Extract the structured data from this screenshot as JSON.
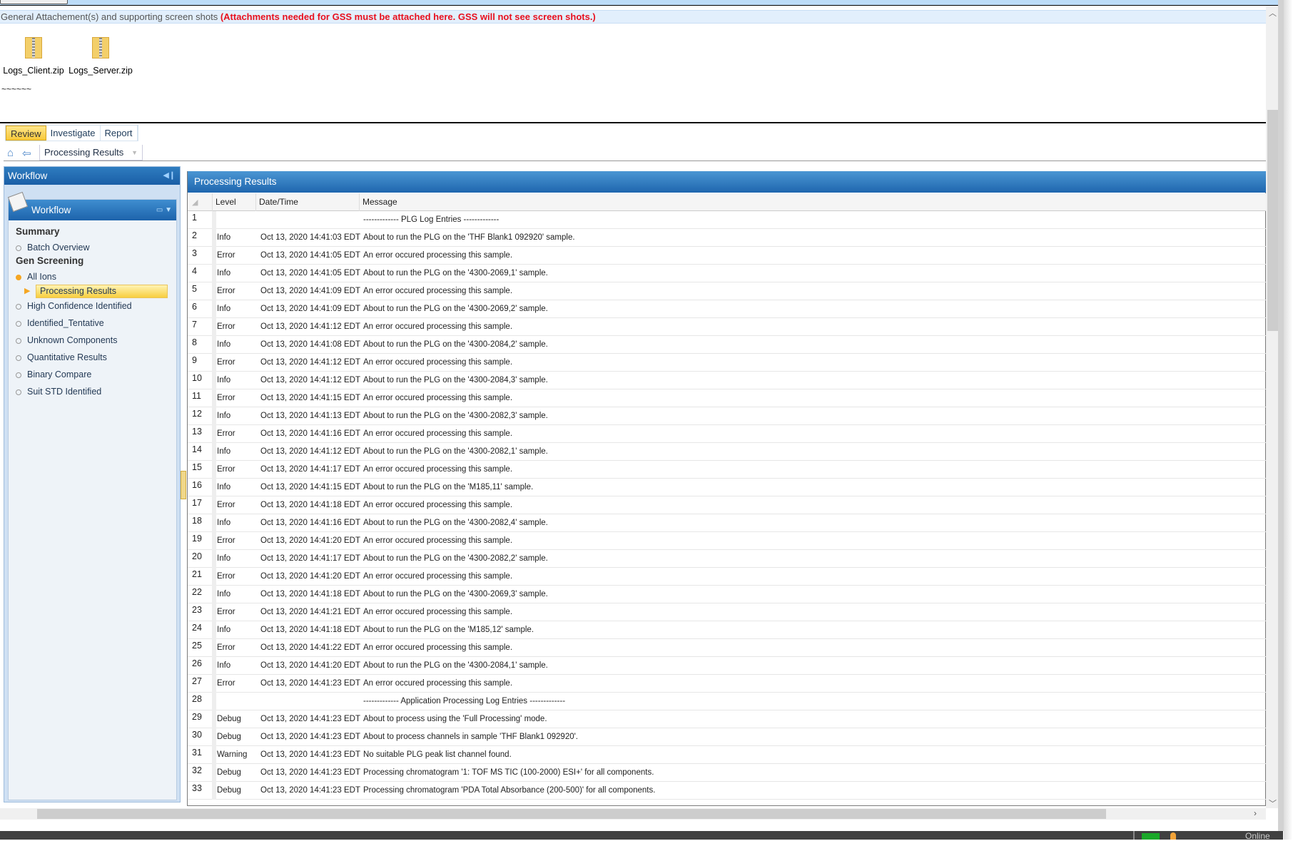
{
  "attachments": {
    "label": "General Attachement(s) and supporting screen shots ",
    "warning": "(Attachments needed for GSS must be attached here.  GSS will not see screen shots.)",
    "files": [
      "Logs_Client.zip",
      "Logs_Server.zip"
    ],
    "tilde": "~~~~~~"
  },
  "tabs": [
    "Review",
    "Investigate",
    "Report"
  ],
  "active_tab": "Review",
  "breadcrumb": {
    "current": "Processing Results"
  },
  "sidebar": {
    "title": "Workflow",
    "panel_title": "Workflow",
    "sections": [
      {
        "label": "Summary"
      },
      {
        "label": "Gen Screening"
      }
    ],
    "items": [
      "Batch Overview",
      "All Ions",
      "Processing Results",
      "High Confidence Identified",
      "Identified_Tentative",
      "Unknown Components",
      "Quantitative Results",
      "Binary Compare",
      "Suit STD Identified"
    ],
    "selected": "Processing Results"
  },
  "main": {
    "title": "Processing Results",
    "columns": [
      "Level",
      "Date/Time",
      "Message"
    ],
    "rows": [
      [
        "1",
        "",
        "",
        "------------- PLG Log Entries  -------------"
      ],
      [
        "2",
        "Info",
        "Oct 13, 2020 14:41:03 EDT",
        "About to run the PLG on the 'THF Blank1 092920' sample."
      ],
      [
        "3",
        "Error",
        "Oct 13, 2020 14:41:05 EDT",
        "An error occured processing this sample."
      ],
      [
        "4",
        "Info",
        "Oct 13, 2020 14:41:05 EDT",
        "About to run the PLG on the '4300-2069,1' sample."
      ],
      [
        "5",
        "Error",
        "Oct 13, 2020 14:41:09 EDT",
        "An error occured processing this sample."
      ],
      [
        "6",
        "Info",
        "Oct 13, 2020 14:41:09 EDT",
        "About to run the PLG on the '4300-2069,2' sample."
      ],
      [
        "7",
        "Error",
        "Oct 13, 2020 14:41:12 EDT",
        "An error occured processing this sample."
      ],
      [
        "8",
        "Info",
        "Oct 13, 2020 14:41:08 EDT",
        "About to run the PLG on the '4300-2084,2' sample."
      ],
      [
        "9",
        "Error",
        "Oct 13, 2020 14:41:12 EDT",
        "An error occured processing this sample."
      ],
      [
        "10",
        "Info",
        "Oct 13, 2020 14:41:12 EDT",
        "About to run the PLG on the '4300-2084,3' sample."
      ],
      [
        "11",
        "Error",
        "Oct 13, 2020 14:41:15 EDT",
        "An error occured processing this sample."
      ],
      [
        "12",
        "Info",
        "Oct 13, 2020 14:41:13 EDT",
        "About to run the PLG on the '4300-2082,3' sample."
      ],
      [
        "13",
        "Error",
        "Oct 13, 2020 14:41:16 EDT",
        "An error occured processing this sample."
      ],
      [
        "14",
        "Info",
        "Oct 13, 2020 14:41:12 EDT",
        "About to run the PLG on the '4300-2082,1' sample."
      ],
      [
        "15",
        "Error",
        "Oct 13, 2020 14:41:17 EDT",
        "An error occured processing this sample."
      ],
      [
        "16",
        "Info",
        "Oct 13, 2020 14:41:15 EDT",
        "About to run the PLG on the 'M185,11' sample."
      ],
      [
        "17",
        "Error",
        "Oct 13, 2020 14:41:18 EDT",
        "An error occured processing this sample."
      ],
      [
        "18",
        "Info",
        "Oct 13, 2020 14:41:16 EDT",
        "About to run the PLG on the '4300-2082,4' sample."
      ],
      [
        "19",
        "Error",
        "Oct 13, 2020 14:41:20 EDT",
        "An error occured processing this sample."
      ],
      [
        "20",
        "Info",
        "Oct 13, 2020 14:41:17 EDT",
        "About to run the PLG on the '4300-2082,2' sample."
      ],
      [
        "21",
        "Error",
        "Oct 13, 2020 14:41:20 EDT",
        "An error occured processing this sample."
      ],
      [
        "22",
        "Info",
        "Oct 13, 2020 14:41:18 EDT",
        "About to run the PLG on the '4300-2069,3' sample."
      ],
      [
        "23",
        "Error",
        "Oct 13, 2020 14:41:21 EDT",
        "An error occured processing this sample."
      ],
      [
        "24",
        "Info",
        "Oct 13, 2020 14:41:18 EDT",
        "About to run the PLG on the 'M185,12' sample."
      ],
      [
        "25",
        "Error",
        "Oct 13, 2020 14:41:22 EDT",
        "An error occured processing this sample."
      ],
      [
        "26",
        "Info",
        "Oct 13, 2020 14:41:20 EDT",
        "About to run the PLG on the '4300-2084,1' sample."
      ],
      [
        "27",
        "Error",
        "Oct 13, 2020 14:41:23 EDT",
        "An error occured processing this sample."
      ],
      [
        "28",
        "",
        "",
        "------------- Application Processing Log Entries  -------------"
      ],
      [
        "29",
        "Debug",
        "Oct 13, 2020 14:41:23 EDT",
        "About to process using the 'Full Processing' mode."
      ],
      [
        "30",
        "Debug",
        "Oct 13, 2020 14:41:23 EDT",
        "About to process channels in sample 'THF Blank1 092920'."
      ],
      [
        "31",
        "Warning",
        "Oct 13, 2020 14:41:23 EDT",
        "No suitable PLG peak list channel found."
      ],
      [
        "32",
        "Debug",
        "Oct 13, 2020 14:41:23 EDT",
        "Processing chromatogram '1: TOF MS TIC (100-2000) ESI+' for all components."
      ],
      [
        "33",
        "Debug",
        "Oct 13, 2020 14:41:23 EDT",
        "Processing chromatogram 'PDA Total Absorbance (200-500)' for all components."
      ]
    ]
  },
  "status": {
    "connection": "Online"
  },
  "colors": {
    "accent": "#1f66ae",
    "selected": "#f8cf3f",
    "warning_text": "#e8101e",
    "status_ok": "#1aa829"
  }
}
